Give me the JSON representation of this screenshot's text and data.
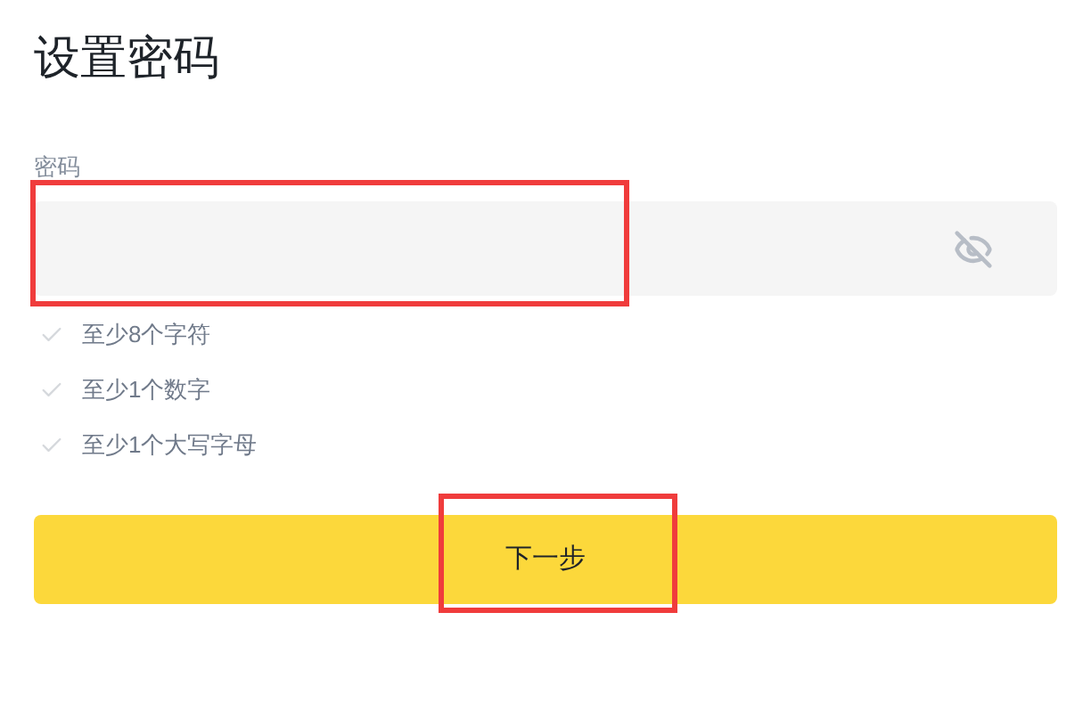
{
  "title": "设置密码",
  "password_field": {
    "label": "密码",
    "masked": true
  },
  "requirements": [
    {
      "text": "至少8个字符",
      "met": false
    },
    {
      "text": "至少1个数字",
      "met": false
    },
    {
      "text": "至少1个大写字母",
      "met": false
    }
  ],
  "next_button": {
    "label": "下一步"
  }
}
